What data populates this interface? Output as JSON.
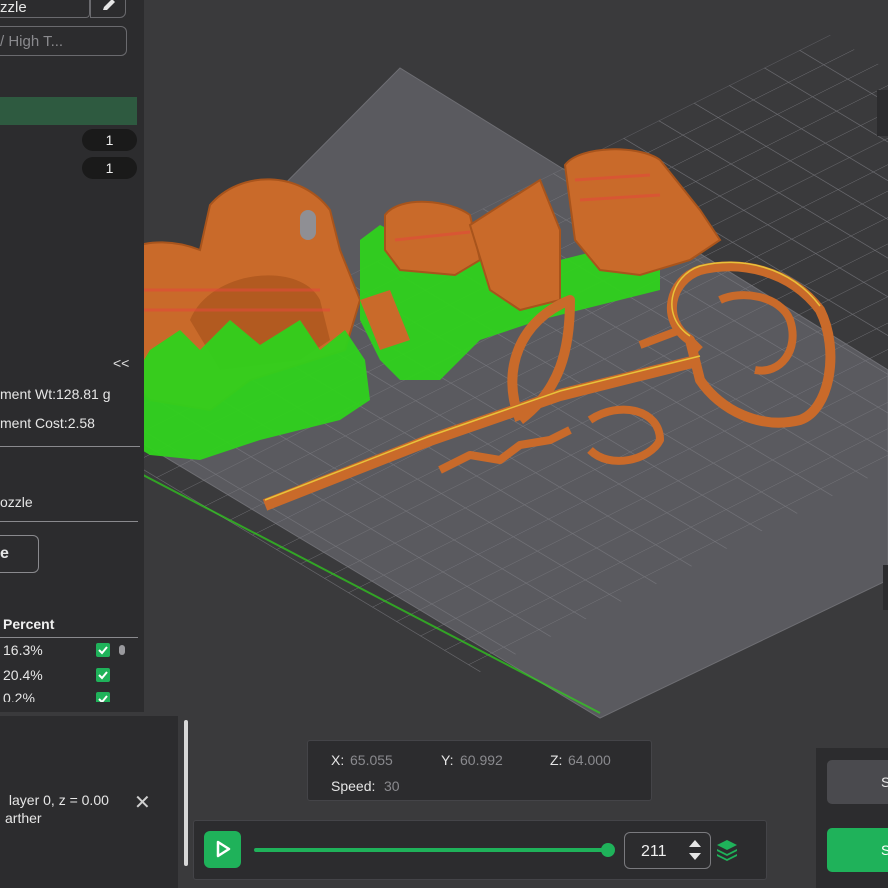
{
  "left": {
    "nozzle_label": "zzle",
    "filter_placeholder": "/ High T...",
    "counts": [
      "1",
      "1"
    ],
    "collapse": "<<",
    "filament_weight": "ment Wt:128.81 g",
    "filament_cost": "ment Cost:2.58",
    "nozzle_text": "ozzle",
    "slice_label": "e",
    "percent_header": "Percent",
    "percent_rows": [
      "16.3%",
      "20.4%",
      "0.2%"
    ]
  },
  "notification": {
    "text": " layer 0, z = 0.00\narther"
  },
  "readout": {
    "x_label": "X:",
    "x_value": "65.055",
    "y_label": "Y:",
    "y_value": "60.992",
    "z_label": "Z:",
    "z_value": "64.000",
    "speed_label": "Speed:",
    "speed_value": "30"
  },
  "slider": {
    "layer": "211",
    "progress": 1.0
  },
  "right": {
    "btn1_label": "S",
    "btn2_label": "S"
  },
  "colors": {
    "accent": "#1fb25a",
    "wall": "#c96a2a",
    "support": "#2fd21c",
    "bed": "#55555a"
  }
}
